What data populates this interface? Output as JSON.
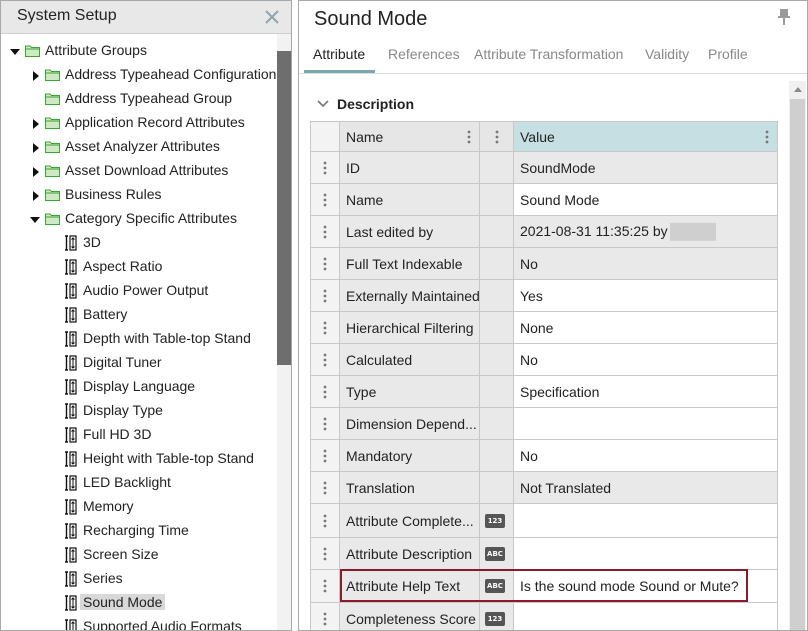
{
  "left_panel": {
    "title": "System Setup",
    "tree": [
      {
        "label": "Attribute Groups",
        "kind": "group",
        "expanded": true,
        "icon": "folder-icon"
      },
      {
        "label": "Address Typeahead Configuration A",
        "kind": "group",
        "expanded": false,
        "icon": "folder-icon"
      },
      {
        "label": "Address Typeahead Group",
        "kind": "group",
        "expanded": null,
        "icon": "folder-icon"
      },
      {
        "label": "Application Record Attributes",
        "kind": "group",
        "expanded": false,
        "icon": "folder-icon"
      },
      {
        "label": "Asset Analyzer Attributes",
        "kind": "group",
        "expanded": false,
        "icon": "folder-icon"
      },
      {
        "label": "Asset Download Attributes",
        "kind": "group",
        "expanded": false,
        "icon": "folder-icon"
      },
      {
        "label": "Business Rules",
        "kind": "group",
        "expanded": false,
        "icon": "folder-icon"
      },
      {
        "label": "Category Specific Attributes",
        "kind": "group",
        "expanded": true,
        "icon": "folder-icon"
      },
      {
        "label": "3D",
        "kind": "attribute",
        "icon": "attribute-icon"
      },
      {
        "label": "Aspect Ratio",
        "kind": "attribute",
        "icon": "attribute-icon"
      },
      {
        "label": "Audio Power Output",
        "kind": "attribute",
        "icon": "attribute-icon"
      },
      {
        "label": "Battery",
        "kind": "attribute",
        "icon": "attribute-icon"
      },
      {
        "label": "Depth with Table-top Stand",
        "kind": "attribute",
        "icon": "attribute-icon"
      },
      {
        "label": "Digital Tuner",
        "kind": "attribute",
        "icon": "attribute-icon"
      },
      {
        "label": "Display Language",
        "kind": "attribute",
        "icon": "attribute-icon"
      },
      {
        "label": "Display Type",
        "kind": "attribute",
        "icon": "attribute-icon"
      },
      {
        "label": "Full HD 3D",
        "kind": "attribute",
        "icon": "attribute-icon"
      },
      {
        "label": "Height with Table-top Stand",
        "kind": "attribute",
        "icon": "attribute-icon"
      },
      {
        "label": "LED Backlight",
        "kind": "attribute",
        "icon": "attribute-icon"
      },
      {
        "label": "Memory",
        "kind": "attribute",
        "icon": "attribute-icon"
      },
      {
        "label": "Recharging Time",
        "kind": "attribute",
        "icon": "attribute-icon"
      },
      {
        "label": "Screen Size",
        "kind": "attribute",
        "icon": "attribute-icon"
      },
      {
        "label": "Series",
        "kind": "attribute",
        "icon": "attribute-icon"
      },
      {
        "label": "Sound Mode",
        "kind": "attribute",
        "icon": "attribute-icon",
        "selected": true
      },
      {
        "label": "Supported Audio Formats",
        "kind": "attribute",
        "icon": "attribute-icon"
      }
    ]
  },
  "right_panel": {
    "title": "Sound Mode",
    "tabs": [
      {
        "label": "Attribute",
        "active": true
      },
      {
        "label": "References",
        "active": false
      },
      {
        "label": "Attribute Transformation",
        "active": false
      },
      {
        "label": "Validity",
        "active": false
      },
      {
        "label": "Profile",
        "active": false
      }
    ],
    "section_title": "Description",
    "grid": {
      "headers": {
        "name": "Name",
        "value": "Value"
      },
      "rows": [
        {
          "name": "ID",
          "type_badge": "",
          "value": "SoundMode",
          "readonly": true
        },
        {
          "name": "Name",
          "type_badge": "",
          "value": "Sound Mode",
          "readonly": false
        },
        {
          "name": "Last edited by",
          "type_badge": "",
          "value": "2021-08-31 11:35:25 by",
          "readonly": true,
          "redacted": true
        },
        {
          "name": "Full Text Indexable",
          "type_badge": "",
          "value": "No",
          "readonly": true
        },
        {
          "name": "Externally Maintained",
          "type_badge": "",
          "value": "Yes",
          "readonly": false
        },
        {
          "name": "Hierarchical Filtering",
          "type_badge": "",
          "value": "None",
          "readonly": false
        },
        {
          "name": "Calculated",
          "type_badge": "",
          "value": "No",
          "readonly": false
        },
        {
          "name": "Type",
          "type_badge": "",
          "value": "Specification",
          "readonly": false
        },
        {
          "name": "Dimension Depend...",
          "type_badge": "",
          "value": "",
          "readonly": false
        },
        {
          "name": "Mandatory",
          "type_badge": "",
          "value": "No",
          "readonly": false
        },
        {
          "name": "Translation",
          "type_badge": "",
          "value": "Not Translated",
          "readonly": true
        },
        {
          "name": "Attribute Complete...",
          "type_badge": "123",
          "value": "",
          "readonly": false
        },
        {
          "name": "Attribute Description",
          "type_badge": "ABC",
          "value": "",
          "readonly": false
        },
        {
          "name": "Attribute Help Text",
          "type_badge": "ABC",
          "value": "Is the sound mode Sound or Mute?",
          "readonly": false,
          "highlighted": true
        },
        {
          "name": "Completeness Score",
          "type_badge": "123",
          "value": "",
          "readonly": false
        }
      ]
    }
  },
  "colors": {
    "active_tab_underline": "#7aa6ad",
    "value_header_bg": "#c5dfe3",
    "highlight_border": "#8b1a2a",
    "folder_green": "#3aa335",
    "expander_black": "#111111"
  }
}
